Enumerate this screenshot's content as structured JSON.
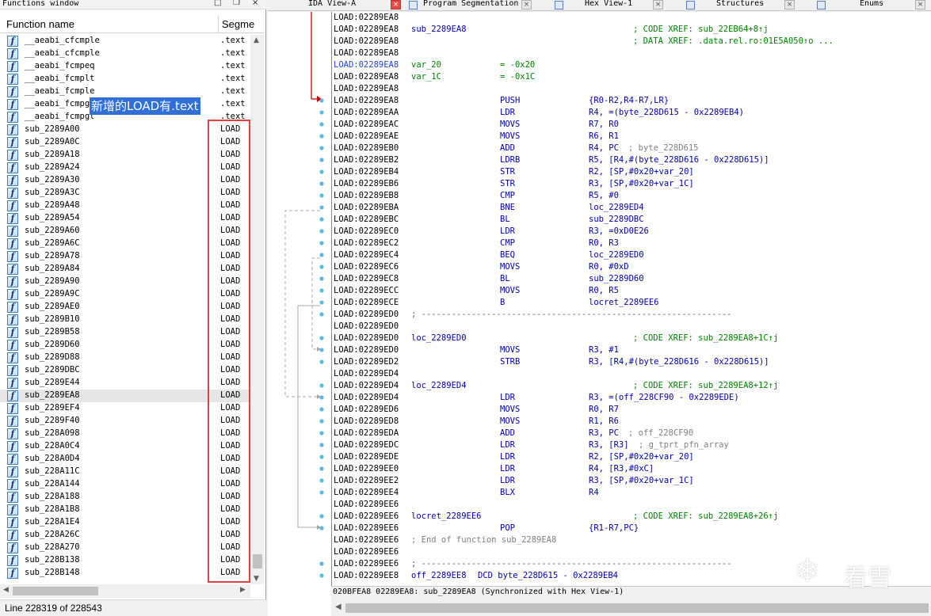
{
  "functions_window": {
    "title": "Functions window",
    "title_buttons": [
      "□",
      "❐",
      "×"
    ],
    "header": {
      "name_col": "Function name",
      "segment_col": "Segme"
    },
    "rows": [
      {
        "name": "__aeabi_cfcmple",
        "seg": ".text"
      },
      {
        "name": "__aeabi_cfcmple",
        "seg": ".text"
      },
      {
        "name": "__aeabi_fcmpeq",
        "seg": ".text"
      },
      {
        "name": "__aeabi_fcmplt",
        "seg": ".text"
      },
      {
        "name": "__aeabi_fcmple",
        "seg": ".text"
      },
      {
        "name": "__aeabi_fcmpge",
        "seg": ".text"
      },
      {
        "name": "__aeabi_fcmpgt",
        "seg": ".text"
      },
      {
        "name": "sub_2289A00",
        "seg": "LOAD"
      },
      {
        "name": "sub_2289A0C",
        "seg": "LOAD"
      },
      {
        "name": "sub_2289A18",
        "seg": "LOAD"
      },
      {
        "name": "sub_2289A24",
        "seg": "LOAD"
      },
      {
        "name": "sub_2289A30",
        "seg": "LOAD"
      },
      {
        "name": "sub_2289A3C",
        "seg": "LOAD"
      },
      {
        "name": "sub_2289A48",
        "seg": "LOAD"
      },
      {
        "name": "sub_2289A54",
        "seg": "LOAD"
      },
      {
        "name": "sub_2289A60",
        "seg": "LOAD"
      },
      {
        "name": "sub_2289A6C",
        "seg": "LOAD"
      },
      {
        "name": "sub_2289A78",
        "seg": "LOAD"
      },
      {
        "name": "sub_2289A84",
        "seg": "LOAD"
      },
      {
        "name": "sub_2289A90",
        "seg": "LOAD"
      },
      {
        "name": "sub_2289A9C",
        "seg": "LOAD"
      },
      {
        "name": "sub_2289AE0",
        "seg": "LOAD"
      },
      {
        "name": "sub_2289B10",
        "seg": "LOAD"
      },
      {
        "name": "sub_2289B58",
        "seg": "LOAD"
      },
      {
        "name": "sub_2289D60",
        "seg": "LOAD"
      },
      {
        "name": "sub_2289D88",
        "seg": "LOAD"
      },
      {
        "name": "sub_2289DBC",
        "seg": "LOAD"
      },
      {
        "name": "sub_2289E44",
        "seg": "LOAD"
      },
      {
        "name": "sub_2289EA8",
        "seg": "LOAD",
        "selected": true
      },
      {
        "name": "sub_2289EF4",
        "seg": "LOAD"
      },
      {
        "name": "sub_2289F40",
        "seg": "LOAD"
      },
      {
        "name": "sub_228A098",
        "seg": "LOAD"
      },
      {
        "name": "sub_228A0C4",
        "seg": "LOAD"
      },
      {
        "name": "sub_228A0D4",
        "seg": "LOAD"
      },
      {
        "name": "sub_228A11C",
        "seg": "LOAD"
      },
      {
        "name": "sub_228A144",
        "seg": "LOAD"
      },
      {
        "name": "sub_228A188",
        "seg": "LOAD"
      },
      {
        "name": "sub_228A1B8",
        "seg": "LOAD"
      },
      {
        "name": "sub_228A1E4",
        "seg": "LOAD"
      },
      {
        "name": "sub_228A26C",
        "seg": "LOAD"
      },
      {
        "name": "sub_228A270",
        "seg": "LOAD"
      },
      {
        "name": "sub_228B138",
        "seg": "LOAD"
      },
      {
        "name": "sub_228B148",
        "seg": "LOAD"
      }
    ],
    "status": "Line 228319 of 228543"
  },
  "annotation": {
    "label": "新增的LOAD有.text",
    "box_color": "#e04040",
    "label_bg": "#2f6fd6"
  },
  "tabs": [
    {
      "label": "IDA View-A",
      "active": true,
      "close": "×"
    },
    {
      "label": "Program Segmentation",
      "close": "×"
    },
    {
      "label": "Hex View-1",
      "close": "×"
    },
    {
      "label": "Structures",
      "close": "×"
    },
    {
      "label": "Enums",
      "close": "×"
    }
  ],
  "disasm": [
    {
      "addr": "LOAD:02289EA8"
    },
    {
      "addr": "LOAD:02289EA8",
      "label": "sub_2289EA8",
      "xref": "; CODE XREF: sub_22EB64+8↑j"
    },
    {
      "addr": "LOAD:02289EA8",
      "xref": "; DATA XREF: .data.rel.ro:01E5A050↑o ..."
    },
    {
      "addr": "LOAD:02289EA8"
    },
    {
      "addr": "LOAD:02289EA8",
      "label": "var_20",
      "assign": "= -0x20",
      "current": true
    },
    {
      "addr": "LOAD:02289EA8",
      "label": "var_1C",
      "assign": "= -0x1C"
    },
    {
      "addr": "LOAD:02289EA8"
    },
    {
      "addr": "LOAD:02289EA8",
      "mnem": "PUSH",
      "ops": "{R0-R2,R4-R7,LR}"
    },
    {
      "addr": "LOAD:02289EAA",
      "mnem": "LDR",
      "ops": "R4, =(byte_228D615 - 0x2289EB4)"
    },
    {
      "addr": "LOAD:02289EAC",
      "mnem": "MOVS",
      "ops": "R7, R0"
    },
    {
      "addr": "LOAD:02289EAE",
      "mnem": "MOVS",
      "ops": "R6, R1"
    },
    {
      "addr": "LOAD:02289EB0",
      "mnem": "ADD",
      "ops": "R4, PC",
      "comment": "; byte_228D615"
    },
    {
      "addr": "LOAD:02289EB2",
      "mnem": "LDRB",
      "ops": "R5, [R4,#(byte_228D616 - 0x228D615)]"
    },
    {
      "addr": "LOAD:02289EB4",
      "mnem": "STR",
      "ops": "R2, [SP,#0x20+var_20]"
    },
    {
      "addr": "LOAD:02289EB6",
      "mnem": "STR",
      "ops": "R3, [SP,#0x20+var_1C]"
    },
    {
      "addr": "LOAD:02289EB8",
      "mnem": "CMP",
      "ops": "R5, #0"
    },
    {
      "addr": "LOAD:02289EBA",
      "mnem": "BNE",
      "ops": "loc_2289ED4"
    },
    {
      "addr": "LOAD:02289EBC",
      "mnem": "BL",
      "ops": "sub_2289DBC"
    },
    {
      "addr": "LOAD:02289EC0",
      "mnem": "LDR",
      "ops": "R3, =0xD0E26"
    },
    {
      "addr": "LOAD:02289EC2",
      "mnem": "CMP",
      "ops": "R0, R3"
    },
    {
      "addr": "LOAD:02289EC4",
      "mnem": "BEQ",
      "ops": "loc_2289ED0"
    },
    {
      "addr": "LOAD:02289EC6",
      "mnem": "MOVS",
      "ops": "R0, #0xD"
    },
    {
      "addr": "LOAD:02289EC8",
      "mnem": "BL",
      "ops": "sub_2289D60"
    },
    {
      "addr": "LOAD:02289ECC",
      "mnem": "MOVS",
      "ops": "R0, R5"
    },
    {
      "addr": "LOAD:02289ECE",
      "mnem": "B",
      "ops": "locret_2289EE6"
    },
    {
      "addr": "LOAD:02289ED0",
      "separator": true
    },
    {
      "addr": "LOAD:02289ED0"
    },
    {
      "addr": "LOAD:02289ED0",
      "label": "loc_2289ED0",
      "xref": "; CODE XREF: sub_2289EA8+1C↑j"
    },
    {
      "addr": "LOAD:02289ED0",
      "mnem": "MOVS",
      "ops": "R3, #1"
    },
    {
      "addr": "LOAD:02289ED2",
      "mnem": "STRB",
      "ops": "R3, [R4,#(byte_228D616 - 0x228D615)]"
    },
    {
      "addr": "LOAD:02289ED4"
    },
    {
      "addr": "LOAD:02289ED4",
      "label": "loc_2289ED4",
      "xref": "; CODE XREF: sub_2289EA8+12↑j"
    },
    {
      "addr": "LOAD:02289ED4",
      "mnem": "LDR",
      "ops": "R3, =(off_228CF90 - 0x2289EDE)"
    },
    {
      "addr": "LOAD:02289ED6",
      "mnem": "MOVS",
      "ops": "R0, R7"
    },
    {
      "addr": "LOAD:02289ED8",
      "mnem": "MOVS",
      "ops": "R1, R6"
    },
    {
      "addr": "LOAD:02289EDA",
      "mnem": "ADD",
      "ops": "R3, PC",
      "comment": "; off_228CF90"
    },
    {
      "addr": "LOAD:02289EDC",
      "mnem": "LDR",
      "ops": "R3, [R3]",
      "comment": "; g_tprt_pfn_array"
    },
    {
      "addr": "LOAD:02289EDE",
      "mnem": "LDR",
      "ops": "R2, [SP,#0x20+var_20]"
    },
    {
      "addr": "LOAD:02289EE0",
      "mnem": "LDR",
      "ops": "R4, [R3,#0xC]"
    },
    {
      "addr": "LOAD:02289EE2",
      "mnem": "LDR",
      "ops": "R3, [SP,#0x20+var_1C]"
    },
    {
      "addr": "LOAD:02289EE4",
      "mnem": "BLX",
      "ops": "R4"
    },
    {
      "addr": "LOAD:02289EE6"
    },
    {
      "addr": "LOAD:02289EE6",
      "label": "locret_2289EE6",
      "xref": "; CODE XREF: sub_2289EA8+26↑j"
    },
    {
      "addr": "LOAD:02289EE6",
      "mnem": "POP",
      "ops": "{R1-R7,PC}"
    },
    {
      "addr": "LOAD:02289EE6",
      "end_comment": "; End of function sub_2289EA8"
    },
    {
      "addr": "LOAD:02289EE6"
    },
    {
      "addr": "LOAD:02289EE6",
      "separator": true
    },
    {
      "addr": "LOAD:02289EE8",
      "label": "off_2289EE8",
      "data": "DCD byte_228D615 - 0x2289EB4"
    }
  ],
  "code_status": "020BFEA8 02289EA8: sub_2289EA8 (Synchronized with Hex View-1)",
  "watermark": {
    "icon": "❄",
    "text": "看雪"
  },
  "colors": {
    "label": "#0000a8",
    "mnemonic": "#0000a8",
    "number": "#008000",
    "comment": "#808080",
    "xref": "#008000",
    "flow_arrow": "#d00000",
    "breakpoint_dot": "#5bb8e8"
  }
}
